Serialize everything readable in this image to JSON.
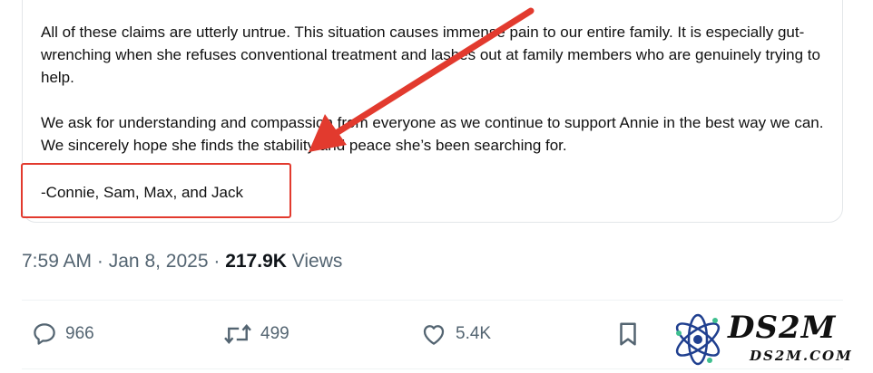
{
  "statement": {
    "paragraph1": "All of these claims are utterly untrue. This situation causes immense pain to our entire family. It is especially gut-wrenching when she refuses conventional treatment and lashes out at family members who are genuinely trying to help.",
    "paragraph2": "We ask for understanding and compassion from everyone as we continue to support Annie in the best way we can. We sincerely hope she finds the stability and peace she’s been searching for.",
    "signature": "-Connie, Sam, Max, and Jack"
  },
  "post_meta": {
    "time": "7:59 AM",
    "separator": "·",
    "date": "Jan 8, 2025",
    "views_count": "217.9K",
    "views_label": "Views"
  },
  "actions": {
    "replies": "966",
    "reposts": "499",
    "likes": "5.4K"
  },
  "annotation": {
    "color": "#e23a2e"
  },
  "watermark": {
    "title": "DS2M",
    "subtitle": "DS2M.COM"
  },
  "icons": {
    "reply": "reply-icon",
    "repost": "repost-icon",
    "like": "heart-icon",
    "bookmark": "bookmark-icon",
    "logo": "atom-logo-icon"
  }
}
